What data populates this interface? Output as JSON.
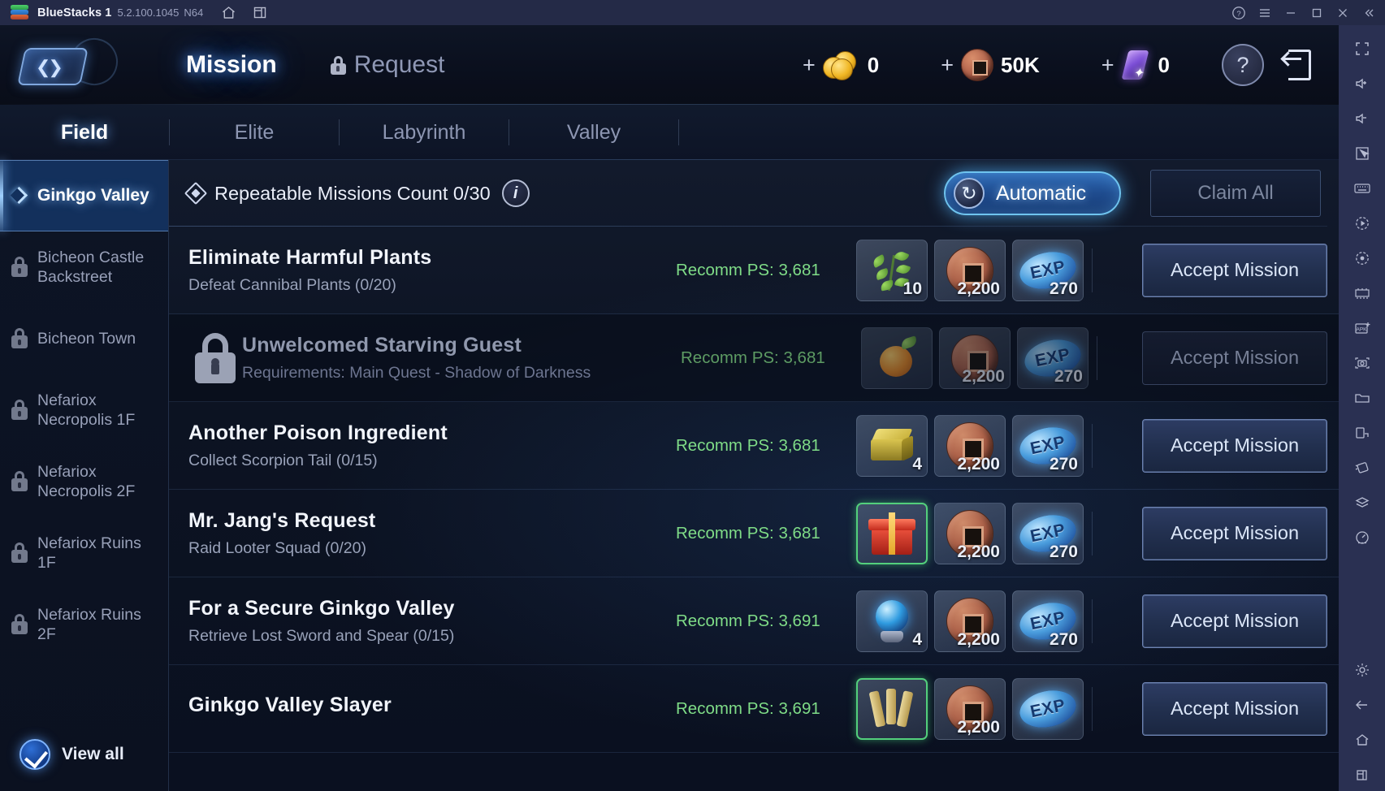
{
  "titlebar": {
    "app_name": "BlueStacks 1",
    "version": "5.2.100.1045",
    "arch": "N64",
    "icons": [
      "home-icon",
      "multi-instance-icon"
    ],
    "controls": [
      "help-icon",
      "menu-icon",
      "minimize-icon",
      "maximize-icon",
      "close-icon",
      "collapse-icon"
    ]
  },
  "game_header": {
    "tabs": [
      {
        "label": "Mission",
        "active": true,
        "locked": false
      },
      {
        "label": "Request",
        "active": false,
        "locked": true
      }
    ],
    "currencies": [
      {
        "name": "gold",
        "plus": "+",
        "value": "0",
        "icon": "gold-coin-icon"
      },
      {
        "name": "copper",
        "plus": "+",
        "value": "50K",
        "icon": "copper-coin-icon"
      },
      {
        "name": "crystal",
        "plus": "+",
        "value": "0",
        "icon": "crystal-icon"
      }
    ],
    "help_label": "?",
    "exit_icon": "exit-door-icon"
  },
  "subtabs": [
    {
      "label": "Field",
      "active": true
    },
    {
      "label": "Elite",
      "active": false
    },
    {
      "label": "Labyrinth",
      "active": false
    },
    {
      "label": "Valley",
      "active": false
    }
  ],
  "sidebar": {
    "items": [
      {
        "label": "Ginkgo Valley",
        "locked": false,
        "active": true
      },
      {
        "label": "Bicheon Castle Backstreet",
        "locked": true,
        "active": false
      },
      {
        "label": "Bicheon Town",
        "locked": true,
        "active": false
      },
      {
        "label": "Nefariox Necropolis 1F",
        "locked": true,
        "active": false
      },
      {
        "label": "Nefariox Necropolis 2F",
        "locked": true,
        "active": false
      },
      {
        "label": "Nefariox Ruins 1F",
        "locked": true,
        "active": false
      },
      {
        "label": "Nefariox Ruins 2F",
        "locked": true,
        "active": false
      }
    ],
    "view_all": {
      "label": "View all",
      "checked": true
    }
  },
  "content_header": {
    "title": "Repeatable Missions Count 0/30",
    "info_label": "i",
    "automatic_label": "Automatic",
    "automatic_icon": "refresh-icon",
    "claim_all_label": "Claim All",
    "claim_all_enabled": false
  },
  "missions": [
    {
      "title": "Eliminate Harmful Plants",
      "subtitle": "Defeat Cannibal Plants (0/20)",
      "power": "Recomm PS: 3,681",
      "locked": false,
      "rewards": [
        {
          "art": "plant",
          "count": "10",
          "highlight": false
        },
        {
          "art": "coin",
          "count": "2,200",
          "highlight": false
        },
        {
          "art": "exp",
          "count": "270",
          "label": "EXP",
          "highlight": false
        }
      ],
      "button": "Accept Mission"
    },
    {
      "title": "Unwelcomed Starving Guest",
      "subtitle": "Requirements: Main Quest - Shadow of Darkness",
      "power": "Recomm PS: 3,681",
      "locked": true,
      "rewards": [
        {
          "art": "fruit",
          "count": "",
          "highlight": false
        },
        {
          "art": "coin",
          "count": "2,200",
          "highlight": false
        },
        {
          "art": "exp",
          "count": "270",
          "label": "EXP",
          "highlight": false
        }
      ],
      "button": "Accept Mission"
    },
    {
      "title": "Another Poison Ingredient",
      "subtitle": "Collect Scorpion Tail (0/15)",
      "power": "Recomm PS: 3,681",
      "locked": false,
      "rewards": [
        {
          "art": "gold",
          "count": "4",
          "highlight": false
        },
        {
          "art": "coin",
          "count": "2,200",
          "highlight": false
        },
        {
          "art": "exp",
          "count": "270",
          "label": "EXP",
          "highlight": false
        }
      ],
      "button": "Accept Mission"
    },
    {
      "title": "Mr. Jang's Request",
      "subtitle": "Raid Looter Squad (0/20)",
      "power": "Recomm PS: 3,681",
      "locked": false,
      "rewards": [
        {
          "art": "redbox",
          "count": "",
          "highlight": true
        },
        {
          "art": "coin",
          "count": "2,200",
          "highlight": false
        },
        {
          "art": "exp",
          "count": "270",
          "label": "EXP",
          "highlight": false
        }
      ],
      "button": "Accept Mission"
    },
    {
      "title": "For a Secure Ginkgo Valley",
      "subtitle": "Retrieve Lost Sword and Spear (0/15)",
      "power": "Recomm PS: 3,691",
      "locked": false,
      "rewards": [
        {
          "art": "orb",
          "count": "4",
          "highlight": false
        },
        {
          "art": "coin",
          "count": "2,200",
          "highlight": false
        },
        {
          "art": "exp",
          "count": "270",
          "label": "EXP",
          "highlight": false
        }
      ],
      "button": "Accept Mission"
    },
    {
      "title": "Ginkgo Valley Slayer",
      "subtitle": "",
      "power": "Recomm PS: 3,691",
      "locked": false,
      "rewards": [
        {
          "art": "scroll",
          "count": "",
          "highlight": true
        },
        {
          "art": "coin",
          "count": "2,200",
          "highlight": false
        },
        {
          "art": "exp",
          "count": "EXP",
          "label": "EXP",
          "highlight": false
        }
      ],
      "button": "Accept Mission"
    }
  ],
  "right_toolbar": {
    "icons": [
      "fullscreen-icon",
      "volume-up-icon",
      "volume-down-icon",
      "pointer-icon",
      "keyboard-icon",
      "macro-play-icon",
      "record-icon",
      "multi-instance-icon",
      "install-apk-icon",
      "screenshot-icon",
      "media-folder-icon",
      "rotate-screen-icon",
      "shake-icon",
      "layers-icon",
      "gauge-icon",
      "settings-icon",
      "back-icon",
      "home-icon",
      "recents-icon"
    ]
  },
  "colors": {
    "accent_blue": "#4a9ae8",
    "power_green": "#7fdc87",
    "titlebar_bg": "#242a47",
    "toolbar_bg": "#2a3052"
  }
}
